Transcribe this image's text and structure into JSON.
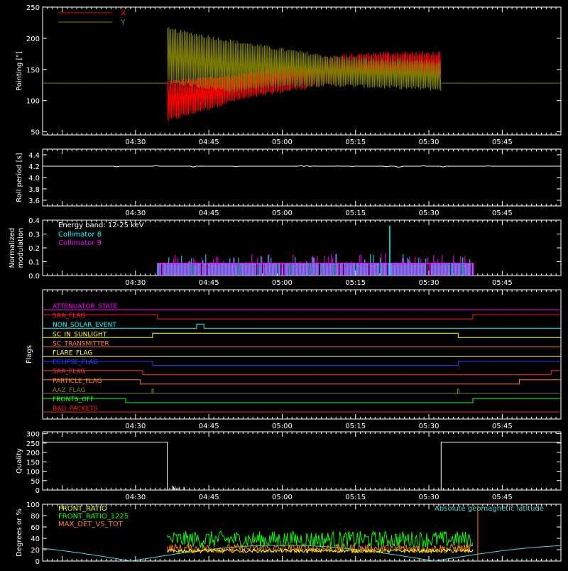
{
  "time_ticks": [
    "04:30",
    "04:45",
    "05:00",
    "05:15",
    "05:30",
    "05:45"
  ],
  "time_tick_minutes": [
    30,
    45,
    60,
    75,
    90,
    105
  ],
  "time_range_minutes": [
    11,
    117
  ],
  "pointing": {
    "ylabel": "Pointing [\"]",
    "yticks": [
      50,
      100,
      150,
      200,
      250
    ],
    "ylim": [
      45,
      250
    ],
    "legend": [
      {
        "name": "X",
        "color": "#ff0000"
      },
      {
        "name": "Y",
        "color": "#808000"
      }
    ],
    "baseline": 128,
    "active_start_min": 36.5,
    "active_end_min": 92.5,
    "x_envelope": {
      "t": [
        36.5,
        50,
        60,
        70,
        80,
        92.5
      ],
      "low": [
        68,
        100,
        115,
        128,
        138,
        140
      ],
      "high": [
        130,
        140,
        155,
        170,
        176,
        176
      ]
    },
    "y_envelope": {
      "t": [
        36.5,
        50,
        60,
        70,
        80,
        92.5
      ],
      "low": [
        130,
        115,
        125,
        125,
        122,
        118
      ],
      "high": [
        215,
        195,
        182,
        170,
        165,
        162
      ]
    }
  },
  "roll": {
    "ylabel": "Roll period [s]",
    "yticks": [
      "3.6",
      "3.8",
      "4.0",
      "4.2",
      "4.4"
    ],
    "ytick_values": [
      3.6,
      3.8,
      4.0,
      4.2,
      4.4
    ],
    "ylim": [
      3.5,
      4.5
    ],
    "value": 4.2
  },
  "modulation": {
    "ylabel_line1": "Normalized",
    "ylabel_line2": "modulation",
    "yticks": [
      "0.0",
      "0.1",
      "0.2",
      "0.3",
      "0.4"
    ],
    "ytick_values": [
      0,
      0.1,
      0.2,
      0.3,
      0.4
    ],
    "ylim": [
      0,
      0.4
    ],
    "energy_label": "Energy band: 12-25 keV",
    "legend": [
      {
        "name": "Collimator 8",
        "color": "#00ffff"
      },
      {
        "name": "Collimator 9",
        "color": "#ff00ff"
      }
    ],
    "active_start_min": 34.5,
    "active_end_min": 99,
    "typical": 0.09,
    "spike_min": 82,
    "spike_value": 0.36
  },
  "flags": {
    "ylabel": "Flags",
    "items": [
      {
        "name": "ATTENUATOR_STATE",
        "color": "#ff00ff",
        "segments": []
      },
      {
        "name": "SAA_FLAG",
        "color": "#ff2020",
        "segments": [
          [
            11,
            34.5,
            0
          ],
          [
            34.5,
            99,
            1
          ],
          [
            99,
            117,
            0
          ]
        ]
      },
      {
        "name": "NON_SOLAR_EVENT",
        "color": "#00ffff",
        "segments": [
          [
            11,
            42.5,
            1
          ],
          [
            42.5,
            44,
            0
          ],
          [
            44,
            117,
            1
          ]
        ]
      },
      {
        "name": "SC_IN_SUNLIGHT",
        "color": "#ffff00",
        "segments": [
          [
            11,
            33.5,
            1
          ],
          [
            33.5,
            96,
            0
          ],
          [
            96,
            117,
            1
          ]
        ]
      },
      {
        "name": "SC_TRANSMITTER",
        "color": "#ff8040",
        "segments": []
      },
      {
        "name": "FLARE_FLAG",
        "color": "#ffff40",
        "segments": []
      },
      {
        "name": "ECLIPSE_FLAG",
        "color": "#2040ff",
        "segments": [
          [
            11,
            33.5,
            0
          ],
          [
            33.5,
            96,
            1
          ],
          [
            96,
            117,
            0
          ]
        ]
      },
      {
        "name": "SAA_FLAG",
        "color": "#ff3030",
        "segments": [
          [
            11,
            31.5,
            0
          ],
          [
            31.5,
            115,
            1
          ],
          [
            115,
            117,
            0
          ]
        ]
      },
      {
        "name": "PARTICLE_FLAG",
        "color": "#ff8020",
        "segments": [
          [
            11,
            31,
            0
          ],
          [
            31,
            108.5,
            1
          ],
          [
            108.5,
            117,
            0
          ]
        ]
      },
      {
        "name": "AAZ_FLAG",
        "color": "#808020",
        "segments": [
          [
            11,
            117,
            1
          ]
        ],
        "pulses": [
          33.5,
          96
        ]
      },
      {
        "name": "FRONTS_OFF",
        "color": "#20ff20",
        "segments": [
          [
            11,
            28,
            0
          ],
          [
            28,
            99,
            1
          ],
          [
            99,
            117,
            0
          ]
        ]
      },
      {
        "name": "BAD_PACKETS",
        "color": "#ff2020",
        "segments": []
      }
    ]
  },
  "quality": {
    "ylabel": "Quality",
    "yticks": [
      0,
      50,
      100,
      150,
      200,
      250,
      300
    ],
    "ylim": [
      0,
      310
    ],
    "segments": [
      [
        11,
        36.5,
        255
      ],
      [
        36.5,
        92.5,
        0
      ],
      [
        92.5,
        117,
        255
      ]
    ]
  },
  "ratios": {
    "ylabel": "Degrees or %",
    "yticks": [
      0,
      20,
      40,
      60,
      80,
      100
    ],
    "ylim": [
      0,
      100
    ],
    "legend": [
      {
        "name": "FRONT_RATIO",
        "color": "#ffff00"
      },
      {
        "name": "FRONT_RATIO_1225",
        "color": "#00ff00"
      },
      {
        "name": "MAX_DET_VS_TOT",
        "color": "#ff8000"
      }
    ],
    "geo_label": "Absolute geomagnetic latitude",
    "geo_color": "#40e0e0",
    "marker_min": 100,
    "active_start_min": 36.5,
    "active_end_min": 99,
    "front_ratio_1225_mean": 38,
    "max_det_mean": 22,
    "front_ratio_mean": 18
  }
}
